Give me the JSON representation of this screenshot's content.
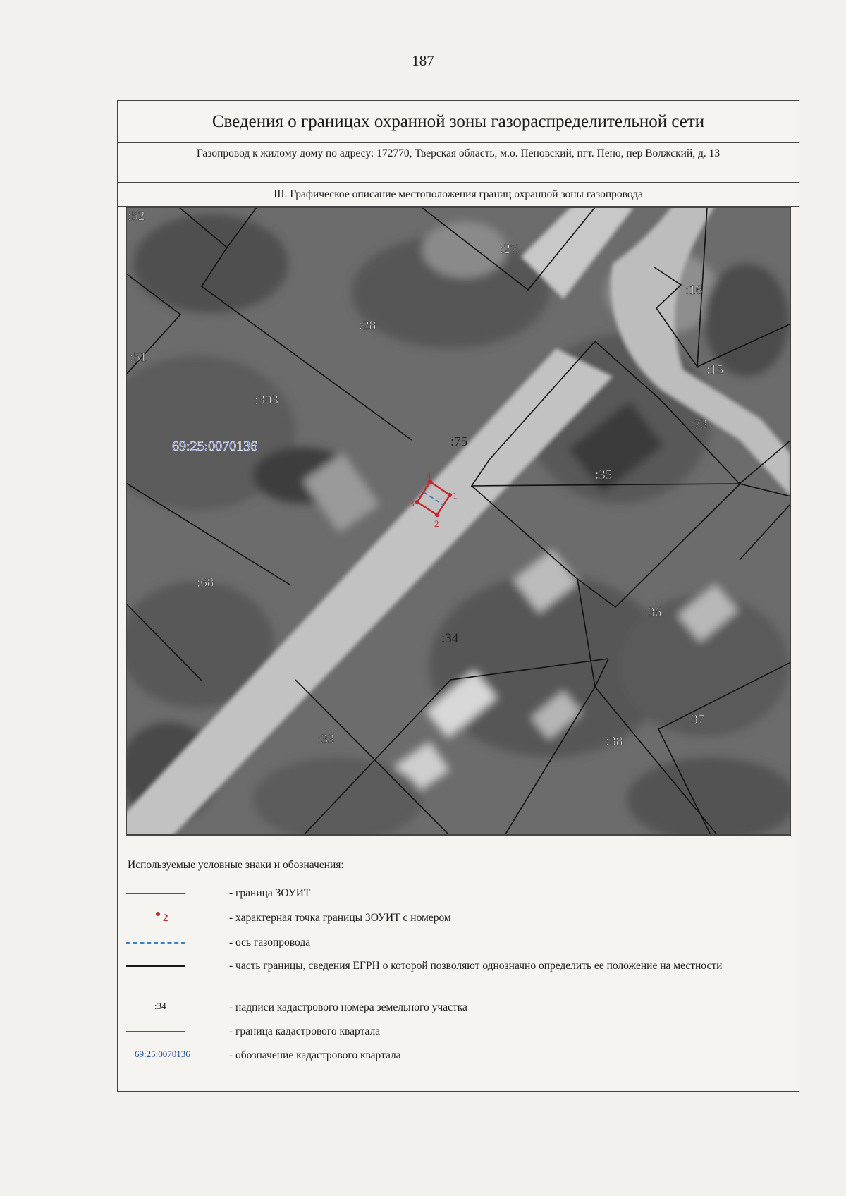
{
  "page_number": "187",
  "document": {
    "title": "Сведения о границах охранной зоны газораспределительной сети",
    "subtitle": "Газопровод к жилому дому по адресу: 172770, Тверская область, м.о. Пеновский, пгт. Пено, пер Волжский, д. 13",
    "section": "III. Графическое описание местоположения границ охранной зоны газопровода"
  },
  "map": {
    "quarter_label": "69:25:0070136",
    "parcels": [
      ":52",
      ":27",
      ":16",
      ":28",
      ":51",
      ":15",
      ":303",
      ":73",
      ":75",
      ":35",
      ":68",
      ":36",
      ":34",
      ":37",
      ":33",
      ":38"
    ],
    "points": [
      "1",
      "2",
      "3",
      "4"
    ]
  },
  "legend": {
    "title": "Используемые условные знаки и обозначения:",
    "items": [
      {
        "symbol": "red-line",
        "label": "- граница ЗОУИТ"
      },
      {
        "symbol": "red-point",
        "symbol_text": "2",
        "label": "- характерная точка границы ЗОУИТ с номером"
      },
      {
        "symbol": "blue-dash",
        "label": "- ось газопровода"
      },
      {
        "symbol": "black-line",
        "label": "- часть границы, сведения ЕГРН о которой позволяют однозначно определить ее положение на местности"
      },
      {
        "symbol": "parcel-text",
        "symbol_text": ":34",
        "label": "- надписи кадастрового номера земельного участка"
      },
      {
        "symbol": "blue-line",
        "label": "- граница кадастрового квартала"
      },
      {
        "symbol": "quarter-text",
        "symbol_text": "69:25:0070136",
        "label": "- обозначение кадастрового квартала"
      }
    ]
  },
  "colors": {
    "zone_boundary": "#c0282d",
    "pipeline_axis": "#3e7ec4",
    "quarter_boundary": "#2f5fa8",
    "quarter_label": "#2a4f9a"
  }
}
